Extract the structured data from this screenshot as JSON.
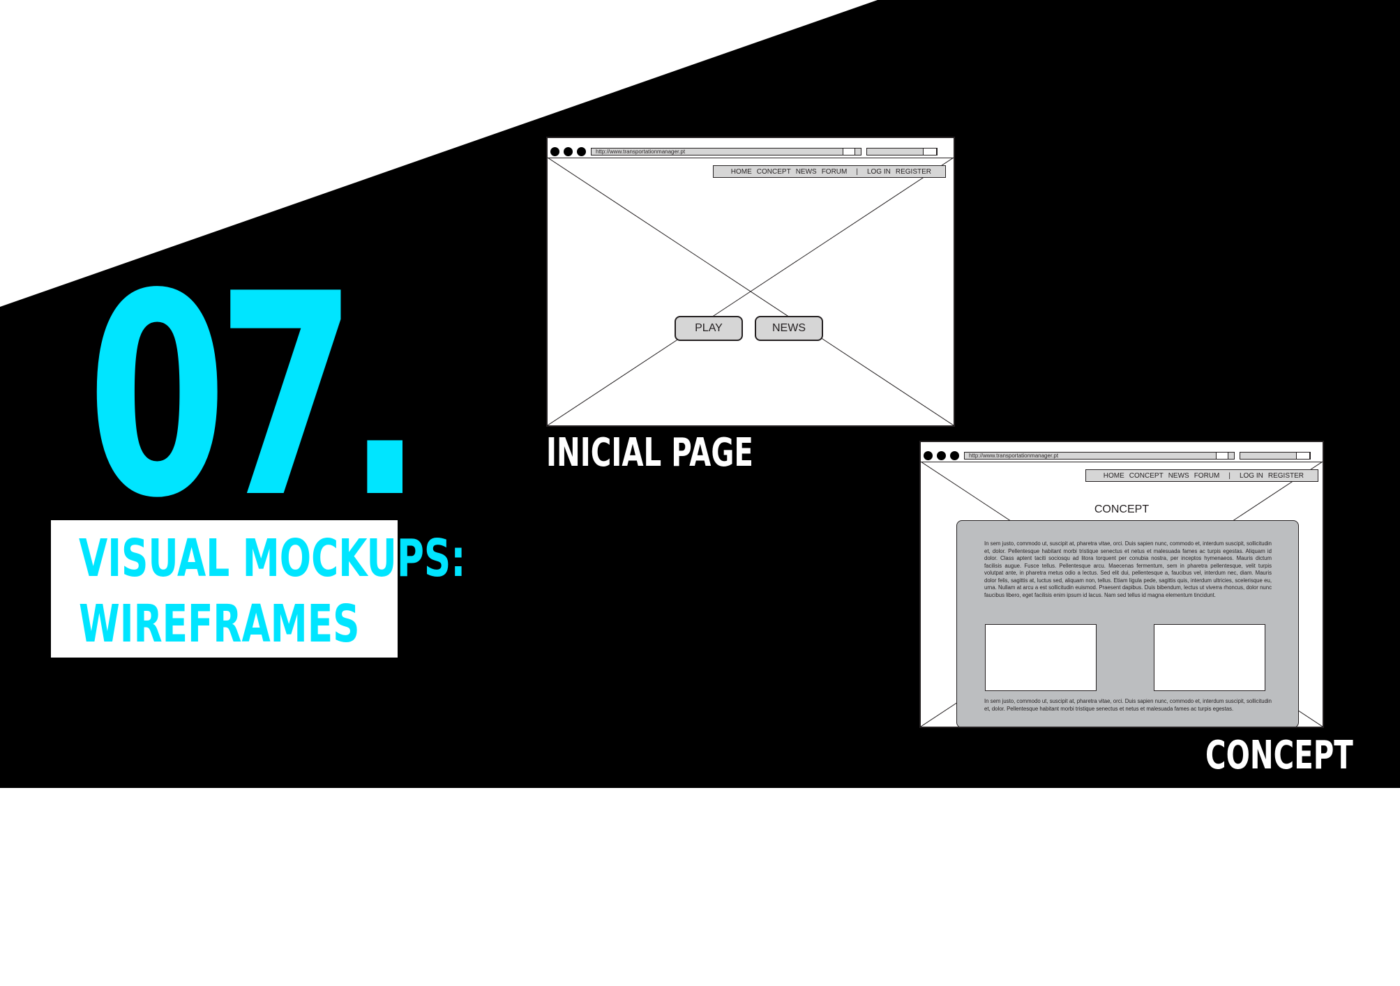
{
  "slide": {
    "number": "07.",
    "title_line_1": "VISUAL MOCKUPS:",
    "title_line_2": "WIREFRAMES",
    "colors": {
      "accent": "#00e5ff",
      "background_band": "#000000",
      "page": "#ffffff",
      "wireframe_fill": "#d6d6d6",
      "panel_fill": "#bcbec0"
    }
  },
  "wireframe_inicial": {
    "caption": "INICIAL PAGE",
    "url": "http://www.transportationmanager.pt",
    "nav": {
      "home": "HOME",
      "concept": "CONCEPT",
      "news": "NEWS",
      "forum": "FORUM",
      "divider": "|",
      "login": "LOG IN",
      "register": "REGISTER"
    },
    "buttons": {
      "play": "PLAY",
      "news": "NEWS"
    }
  },
  "wireframe_concept": {
    "caption": "CONCEPT",
    "url": "http://www.transportationmanager.pt",
    "nav": {
      "home": "HOME",
      "concept": "CONCEPT",
      "news": "NEWS",
      "forum": "FORUM",
      "divider": "|",
      "login": "LOG IN",
      "register": "REGISTER"
    },
    "heading": "CONCEPT",
    "paragraph_1": "In sem justo, commodo ut, suscipit at, pharetra vitae, orci. Duis sapien nunc, commodo et, interdum suscipit, sollicitudin et, dolor. Pellentesque habitant morbi tristique senectus et netus et malesuada fames ac turpis egestas. Aliquam id dolor. Class aptent taciti sociosqu ad litora torquent per conubia nostra, per inceptos hymenaeos. Mauris dictum facilisis augue. Fusce tellus. Pellentesque arcu. Maecenas fermentum, sem in pharetra pellentesque, velit turpis volutpat ante, in pharetra metus odio a lectus. Sed elit dui, pellentesque a, faucibus vel, interdum nec, diam. Mauris dolor felis, sagittis at, luctus sed, aliquam non, tellus. Etiam ligula pede, sagittis quis, interdum ultricies, scelerisque eu, urna. Nullam at arcu a est sollicitudin euismod. Praesent dapibus. Duis bibendum, lectus ut viverra rhoncus, dolor nunc faucibus libero, eget facilisis enim ipsum id lacus. Nam sed tellus id magna elementum tincidunt.",
    "paragraph_2": "In sem justo, commodo ut, suscipit at, pharetra vitae, orci. Duis sapien nunc, commodo et, interdum suscipit, sollicitudin et, dolor. Pellentesque habitant morbi tristique senectus et netus et malesuada fames ac turpis egestas."
  }
}
